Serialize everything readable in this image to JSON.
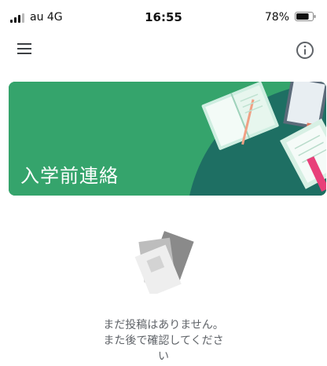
{
  "status_bar": {
    "carrier": "au  4G",
    "time": "16:55",
    "battery_percent": "78%",
    "battery_level": 0.78
  },
  "app_bar": {
    "menu_icon": "hamburger-menu-icon",
    "info_icon": "info-icon"
  },
  "banner": {
    "title": "入学前連絡",
    "background_color": "#34a36b"
  },
  "empty_state": {
    "illustration": "documents-icon",
    "message": "まだ投稿はありません。また後で確認してください"
  }
}
